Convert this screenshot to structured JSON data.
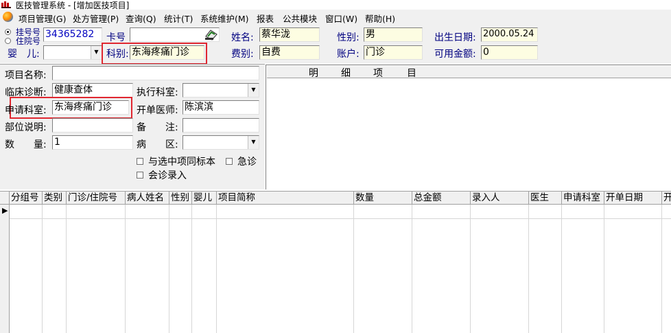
{
  "title": "医技管理系统 - [增加医技项目]",
  "menu": [
    "项目管理(G)",
    "处方管理(P)",
    "查询(Q)",
    "统计(T)",
    "系统维护(M)",
    "报表",
    "公共模块",
    "窗口(W)",
    "帮助(H)"
  ],
  "patient": {
    "reg_no_label": "挂号号",
    "inpatient_no_label": "住院号",
    "reg_no_value": "34365282",
    "card_label": "卡号",
    "card_value": "",
    "name_label": "姓名:",
    "name_value": "蔡华泷",
    "gender_label": "性别:",
    "gender_value": "男",
    "dob_label": "出生日期:",
    "dob_value": "2000.05.24",
    "infant_label": "婴　儿:",
    "infant_value": "",
    "dept_label": "科别:",
    "dept_value": "东海疼痛门诊",
    "fee_type_label": "费别:",
    "fee_type_value": "自费",
    "account_label": "账户:",
    "account_value": "门诊",
    "balance_label": "可用金额:",
    "balance_value": "0"
  },
  "form": {
    "item_name_label": "项目名称:",
    "item_name_value": "",
    "diagnosis_label": "临床诊断:",
    "diagnosis_value": "健康查体",
    "exec_dept_label": "执行科室:",
    "exec_dept_value": "",
    "apply_dept_label": "申请科室:",
    "apply_dept_value": "东海疼痛门诊",
    "doctor_label": "开单医师:",
    "doctor_value": "陈滨滨",
    "site_label": "部位说明:",
    "site_value": "",
    "note_label": "备　　注:",
    "note_value": "",
    "qty_label": "数　　量:",
    "qty_value": "1",
    "ward_label": "病　　区:",
    "ward_value": "",
    "same_specimen_label": "与选中项同标本",
    "urgent_label": "急诊",
    "consult_label": "会诊录入"
  },
  "detail_header": [
    "明",
    "细",
    "项",
    "目"
  ],
  "grid_columns": [
    "分组号",
    "类别",
    "门诊/住院号",
    "病人姓名",
    "性别",
    "婴儿",
    "项目简称",
    "数量",
    "总金额",
    "录入人",
    "医生",
    "申请科室",
    "开单日期",
    "开"
  ],
  "row_indicator": "▶",
  "icons": {
    "app": "app-icon",
    "card": "card-reader-icon",
    "dropdown": "dropdown-arrow-icon"
  },
  "colors": {
    "highlight": "#e0262f",
    "yellow_field": "#fdfde2",
    "link_blue": "#000080"
  }
}
